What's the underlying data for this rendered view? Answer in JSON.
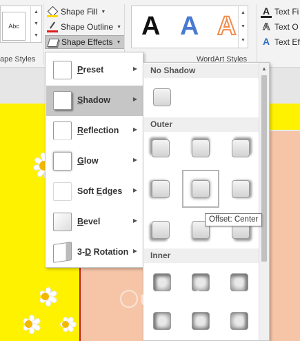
{
  "ribbon": {
    "shape_styles": {
      "gallery_item": "Abc",
      "group_label": "ape Styles",
      "fill_label": "Shape Fill",
      "outline_label": "Shape Outline",
      "effects_label": "Shape Effects"
    },
    "wordart": {
      "letter": "A",
      "letter_colors": [
        "#111111",
        "#4a7ad0",
        "#f28a4c"
      ],
      "group_label": "WordArt Styles"
    },
    "text_buttons": {
      "fill_label": "Text Fi",
      "outline_label": "Text O",
      "effects_label": "Text Eff"
    }
  },
  "effects_menu": {
    "items": [
      {
        "label": "Preset",
        "accel": "P"
      },
      {
        "label": "Shadow",
        "accel": "S",
        "active": true
      },
      {
        "label": "Reflection",
        "accel": "R"
      },
      {
        "label": "Glow",
        "accel": "G"
      },
      {
        "label": "Soft Edges",
        "accel": "E"
      },
      {
        "label": "Bevel",
        "accel": "B"
      },
      {
        "label": "3-D Rotation",
        "accel": "D"
      }
    ]
  },
  "shadow_menu": {
    "sections": {
      "no_shadow": "No Shadow",
      "outer": "Outer",
      "inner": "Inner"
    },
    "selected": "Offset: Center",
    "tooltip": "Offset: Center"
  },
  "colors": {
    "slide_yellow": "#fff200",
    "slide_peach": "#f6c5a8",
    "selection_gray": "#c6c6c6"
  },
  "watermark": "uantrimang"
}
